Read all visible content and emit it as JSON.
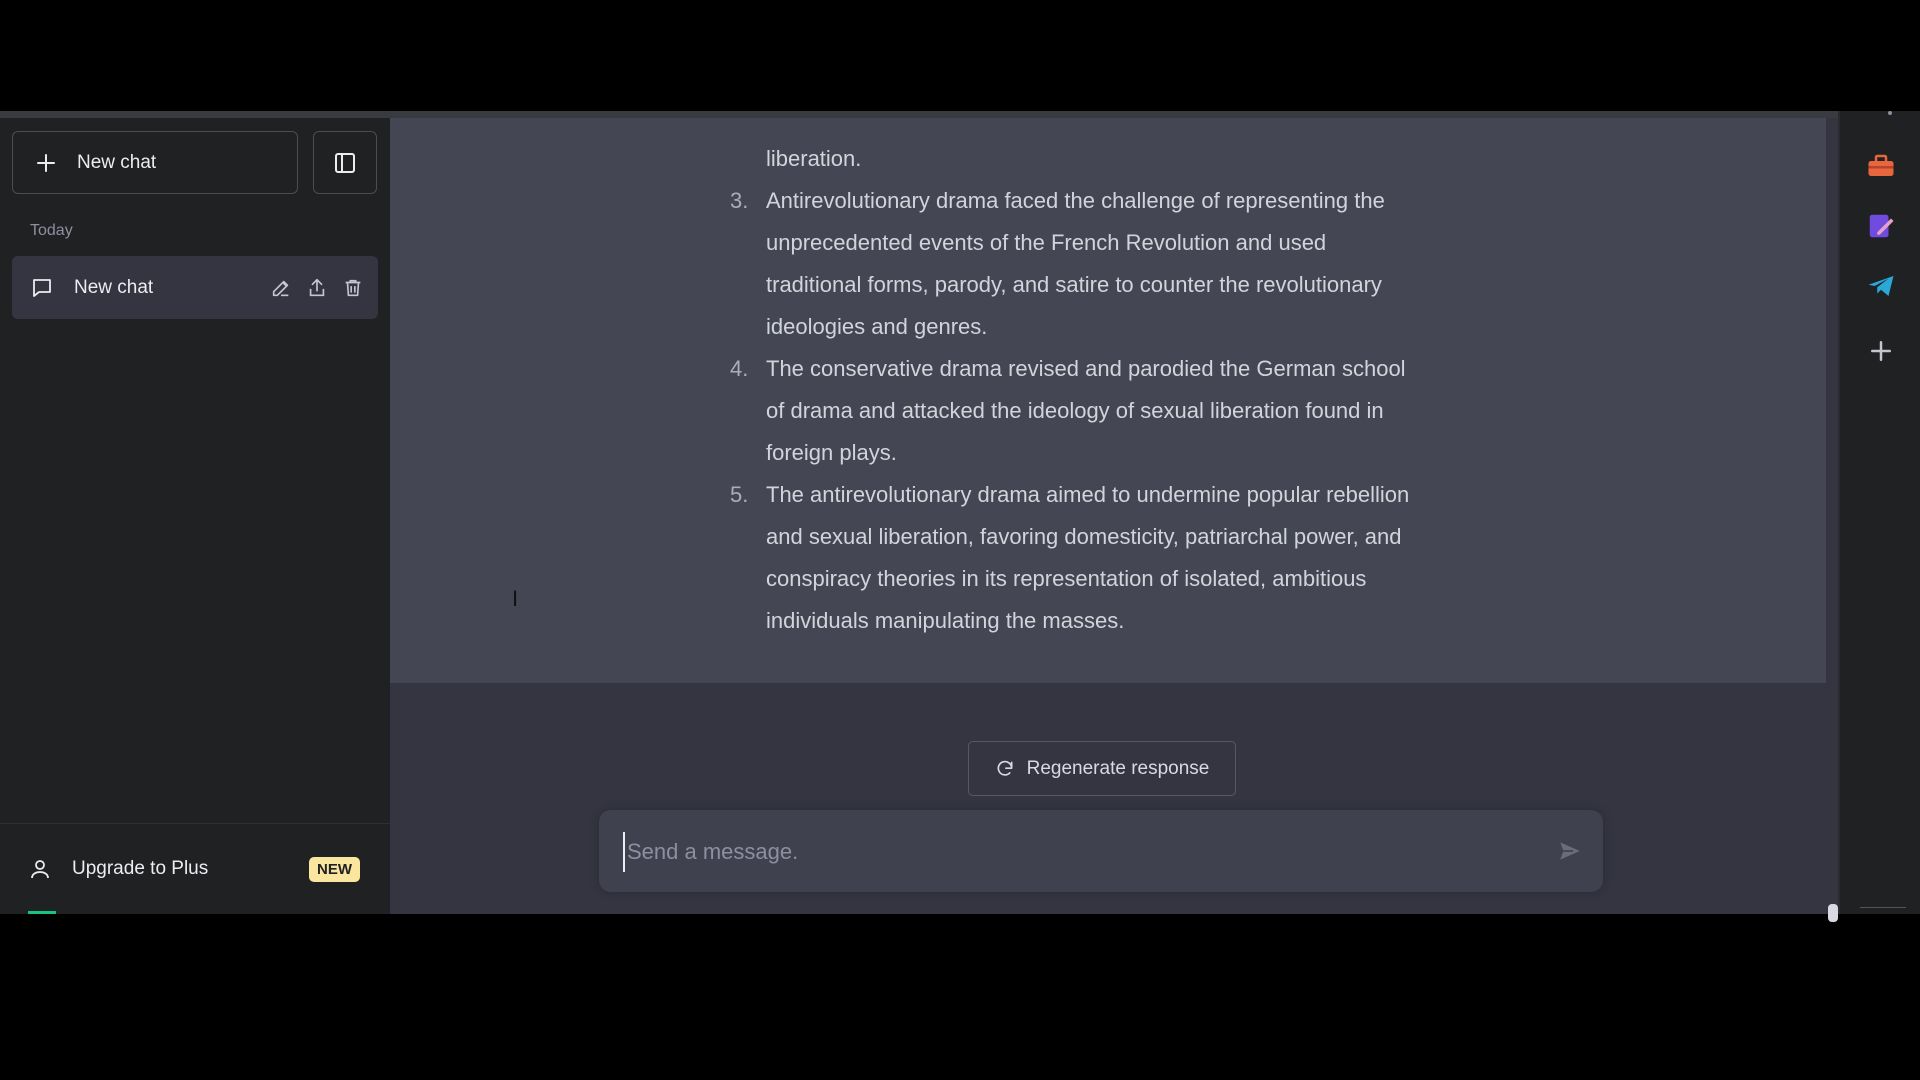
{
  "sidebar": {
    "new_chat_label": "New chat",
    "section_today": "Today",
    "chat_items": [
      {
        "label": "New chat"
      }
    ],
    "upgrade_label": "Upgrade to Plus",
    "upgrade_badge": "NEW"
  },
  "conversation": {
    "answer_lines": [
      {
        "num": "",
        "text": "liberation."
      },
      {
        "num": "3.",
        "text": "Antirevolutionary drama faced the challenge of representing the"
      },
      {
        "num": "",
        "text": "unprecedented events of the French Revolution and used"
      },
      {
        "num": "",
        "text": "traditional forms, parody, and satire to counter the revolutionary"
      },
      {
        "num": "",
        "text": "ideologies and genres."
      },
      {
        "num": "4.",
        "text": "The conservative drama revised and parodied the German school"
      },
      {
        "num": "",
        "text": "of drama and attacked the ideology of sexual liberation found in"
      },
      {
        "num": "",
        "text": "foreign plays."
      },
      {
        "num": "5.",
        "text": "The antirevolutionary drama aimed to undermine popular rebellion"
      },
      {
        "num": "",
        "text": "and sexual liberation, favoring domesticity, patriarchal power, and"
      },
      {
        "num": "",
        "text": "conspiracy theories in its representation of isolated, ambitious"
      },
      {
        "num": "",
        "text": "individuals manipulating the masses."
      }
    ]
  },
  "regenerate_label": "Regenerate response",
  "composer": {
    "placeholder": "Send a message.",
    "value": ""
  },
  "colors": {
    "sidebar_bg": "#202123",
    "main_bg": "#343541",
    "answer_bg": "#444654",
    "badge_bg": "#fae69e"
  },
  "icons": {
    "new_chat": "plus-icon",
    "toggle": "sidebar-toggle-icon",
    "chat": "message-icon",
    "edit": "pencil-icon",
    "share": "share-icon",
    "delete": "trash-icon",
    "user": "user-icon",
    "regenerate": "refresh-icon",
    "send": "send-icon",
    "rail": [
      "toolbox-icon",
      "pen-note-icon",
      "telegram-icon",
      "plus-icon"
    ]
  }
}
